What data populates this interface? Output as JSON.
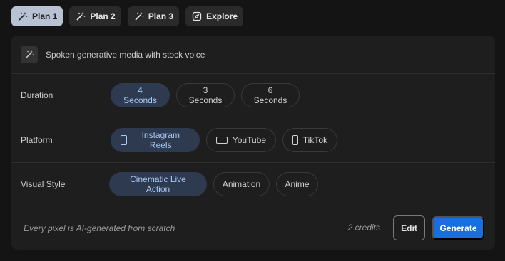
{
  "tabs": [
    {
      "label": "Plan 1",
      "icon": "sparkle-wand-icon",
      "active": true
    },
    {
      "label": "Plan 2",
      "icon": "sparkle-wand-icon",
      "active": false
    },
    {
      "label": "Plan 3",
      "icon": "sparkle-wand-icon",
      "active": false
    },
    {
      "label": "Explore",
      "icon": "compass-icon",
      "active": false
    }
  ],
  "header": {
    "icon": "sparkle-wand-icon",
    "text": "Spoken generative media with stock voice"
  },
  "duration": {
    "label": "Duration",
    "options": [
      "4 Seconds",
      "3 Seconds",
      "6 Seconds"
    ],
    "selected": "4 Seconds"
  },
  "platform": {
    "label": "Platform",
    "options": [
      {
        "label": "Instagram Reels",
        "icon": "phone-portrait-icon"
      },
      {
        "label": "YouTube",
        "icon": "screen-landscape-icon"
      },
      {
        "label": "TikTok",
        "icon": "phone-portrait-icon"
      }
    ],
    "selected": "Instagram Reels"
  },
  "visual_style": {
    "label": "Visual Style",
    "options": [
      "Cinematic Live Action",
      "Animation",
      "Anime"
    ],
    "selected": "Cinematic Live Action"
  },
  "footer": {
    "note": "Every pixel is AI-generated from scratch",
    "credits": "2 credits",
    "edit_label": "Edit",
    "generate_label": "Generate"
  },
  "colors": {
    "accent": "#1a6fe0",
    "selected_pill_bg": "#2d3a50",
    "selected_pill_text": "#a9c8f3",
    "active_tab_bg": "#b8c2d2"
  }
}
